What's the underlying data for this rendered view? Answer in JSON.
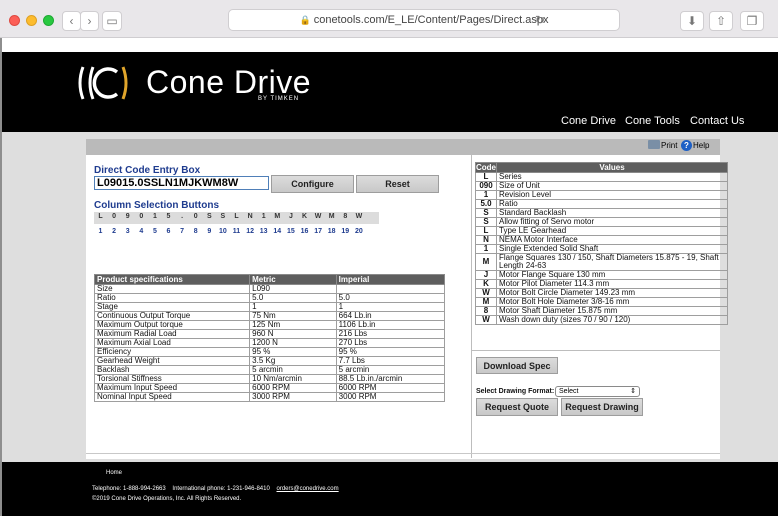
{
  "browser": {
    "url": "conetools.com/E_LE/Content/Pages/Direct.aspx",
    "icons": [
      "back-icon",
      "forward-icon",
      "sidebar-icon",
      "lock-icon",
      "reload-icon",
      "download-icon",
      "share-icon",
      "tabs-icon"
    ]
  },
  "brand": {
    "name": "Cone Drive",
    "sub": "BY TIMKEN",
    "accent": "#e0a52b"
  },
  "nav": [
    "Cone Drive",
    "Cone Tools",
    "Contact Us"
  ],
  "toolbar": {
    "print": "Print",
    "help": "Help"
  },
  "entry": {
    "title": "Direct Code Entry Box",
    "code_value": "L09015.0SSLN1MJKWM8W",
    "configure_label": "Configure",
    "reset_label": "Reset"
  },
  "column_selection": {
    "title": "Column Selection Buttons",
    "letters": [
      "L",
      "0",
      "9",
      "0",
      "1",
      "5",
      ".",
      "0",
      "S",
      "S",
      "L",
      "N",
      "1",
      "M",
      "J",
      "K",
      "W",
      "M",
      "8",
      "W"
    ],
    "numbers": [
      "1",
      "2",
      "3",
      "4",
      "5",
      "6",
      "7",
      "8",
      "9",
      "10",
      "11",
      "12",
      "13",
      "14",
      "15",
      "16",
      "17",
      "18",
      "19",
      "20"
    ]
  },
  "specs": {
    "headers": [
      "Product specifications",
      "Metric",
      "Imperial"
    ],
    "rows": [
      [
        "Size",
        "L090",
        ""
      ],
      [
        "Ratio",
        "5.0",
        "5.0"
      ],
      [
        "Stage",
        "1",
        "1"
      ],
      [
        "Continuous Output Torque",
        "75 Nm",
        "664 Lb.in"
      ],
      [
        "Maximum Output torque",
        "125 Nm",
        "1106 Lb.in"
      ],
      [
        "Maximum Radial Load",
        "960 N",
        "216 Lbs"
      ],
      [
        "Maximum Axial Load",
        "1200 N",
        "270 Lbs"
      ],
      [
        "Efficiency",
        "95 %",
        "95 %"
      ],
      [
        "Gearhead Weight",
        "3.5 Kg",
        "7.7 Lbs"
      ],
      [
        "Backlash",
        "5 arcmin",
        "5 arcmin"
      ],
      [
        "Torsional Stiffness",
        "10 Nm/arcmin",
        "88.5 Lb.in./arcmin"
      ],
      [
        "Maximum Input Speed",
        "6000 RPM",
        "6000 RPM"
      ],
      [
        "Nominal Input Speed",
        "3000 RPM",
        "3000 RPM"
      ]
    ]
  },
  "codes": {
    "headers": [
      "Code",
      "Values"
    ],
    "rows": [
      [
        "L",
        "Series"
      ],
      [
        "090",
        "Size of Unit"
      ],
      [
        "1",
        "Revision Level"
      ],
      [
        "5.0",
        "Ratio"
      ],
      [
        "S",
        "Standard Backlash"
      ],
      [
        "S",
        "Allow fitting of Servo motor"
      ],
      [
        "L",
        "Type LE Gearhead"
      ],
      [
        "N",
        "NEMA Motor Interface"
      ],
      [
        "1",
        "Single Extended Solid Shaft"
      ],
      [
        "M",
        "Flange Squares 130 / 150, Shaft Diameters 15.875 - 19, Shaft Length 24-63"
      ],
      [
        "J",
        "Motor Flange Square 130 mm"
      ],
      [
        "K",
        "Motor Pilot Diameter 114.3 mm"
      ],
      [
        "W",
        "Motor Bolt Circle Diameter 149.23 mm"
      ],
      [
        "M",
        "Motor Bolt Hole Diameter 3/8-16 mm"
      ],
      [
        "8",
        "Motor Shaft Diameter 15.875 mm"
      ],
      [
        "W",
        "Wash down duty (sizes 70 / 90 / 120)"
      ]
    ]
  },
  "actions": {
    "download_spec": "Download Spec",
    "format_label": "Select Drawing Format:",
    "format_value": "Select",
    "request_quote": "Request Quote",
    "request_drawing": "Request Drawing"
  },
  "footer": {
    "home": "Home",
    "telephone": "Telephone: 1-888-994-2663",
    "intl": "International phone: 1-231-946-8410",
    "email": "orders@conedrive.com",
    "copyright": "©2019 Cone Drive Operations, Inc. All Rights Reserved."
  }
}
